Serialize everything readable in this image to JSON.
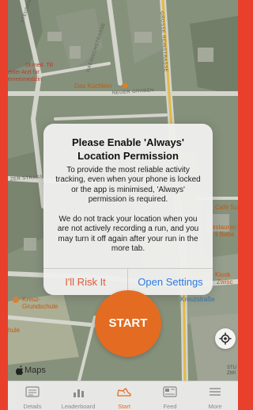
{
  "dialog": {
    "title": "Please Enable 'Always' Location Permission",
    "message1": "To provide the most reliable activity tracking, even when your phone is locked or the app is minimised, 'Always' permission is required.",
    "message2": "We do not track your location when you are not actively recording a run, and you may turn it off again after your run in the more tab.",
    "cancel_label": "I'll Risk It",
    "settings_label": "Open Settings"
  },
  "map": {
    "attribution": "Maps",
    "labels": {
      "doctor_line1": "Dr.med. Till",
      "doctor_line2": "ettler Arzt für",
      "doctor_line3": "emeinmedizin",
      "restaurant": "Das Küchlein",
      "cafe": "Café Su",
      "restaurant2_line1": "estauran",
      "restaurant2_line2": "li Baba",
      "kiosk_line1": "Kiosk",
      "kiosk_line2": "Zwisc",
      "school_line1": "Kreuz-",
      "school_line2": "Grundschule",
      "school2": "hule",
      "square": "Kreuzstraße",
      "stu_line1": "STU",
      "stu_line2": "ZWI",
      "street_steuben": "STEUBENSTRASSE",
      "street_haenisch": "HAENISCHSTRASSE",
      "street_grosse": "GROSSE REINSTRASSE",
      "street_neuer": "NEUER GRABEN",
      "street_zer": "ZER STRASSE"
    }
  },
  "start_label": "START",
  "tabs": [
    {
      "label": "Details",
      "active": false
    },
    {
      "label": "Leaderboard",
      "active": false
    },
    {
      "label": "Start",
      "active": true
    },
    {
      "label": "Feed",
      "active": false
    },
    {
      "label": "More",
      "active": false
    }
  ],
  "colors": {
    "accent": "#e36c22",
    "border": "#e9402c",
    "cancel": "#e05a3a",
    "link": "#2d7be0"
  }
}
